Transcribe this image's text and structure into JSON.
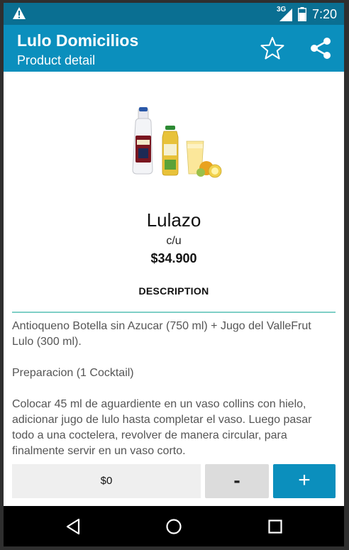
{
  "status_bar": {
    "network": "3G",
    "time": "7:20",
    "icons": [
      "warning-icon",
      "signal-icon",
      "battery-icon"
    ]
  },
  "app_bar": {
    "title": "Lulo Domicilios",
    "subtitle": "Product detail",
    "actions": [
      "star-icon",
      "share-icon"
    ]
  },
  "product": {
    "name": "Lulazo",
    "unit": "c/u",
    "price": "$34.900",
    "description_heading": "DESCRIPTION",
    "description": [
      "Antioqueno Botella sin Azucar (750 ml) + Jugo del ValleFrut Lulo (300 ml).",
      "Preparacion (1 Cocktail)",
      "Colocar 45 ml de aguardiente en un vaso collins con hielo, adicionar jugo de lulo hasta completar el vaso. Luego pasar todo a una coctelera, revolver de manera circular, para finalmente servir en un vaso corto."
    ]
  },
  "cart_bar": {
    "total": "$0",
    "minus_label": "-",
    "plus_label": "+"
  },
  "colors": {
    "status_bar": "#0a6f92",
    "app_bar": "#0b8fbd",
    "divider": "#7fcfc6",
    "plus_button": "#0b8fbd"
  },
  "nav_bar": {
    "icons": [
      "back-icon",
      "home-icon",
      "recent-apps-icon"
    ]
  }
}
